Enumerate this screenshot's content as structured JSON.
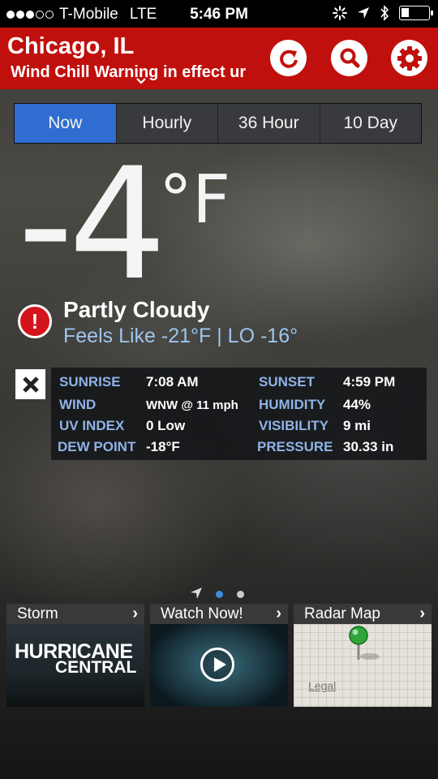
{
  "status_bar": {
    "carrier": "T-Mobile",
    "network": "LTE",
    "time": "5:46 PM"
  },
  "header": {
    "city": "Chicago, IL",
    "alert": "Wind Chill Warning in effect ur",
    "icons": [
      "refresh-icon",
      "search-icon",
      "gear-icon"
    ]
  },
  "tabs": [
    "Now",
    "Hourly",
    "36 Hour",
    "10 Day"
  ],
  "active_tab": "Now",
  "current": {
    "temperature": "-4",
    "unit": "°F",
    "condition": "Partly Cloudy",
    "feels_like": "Feels Like -21°F |  LO -16°"
  },
  "details": [
    {
      "label": "SUNRISE",
      "value": "7:08 AM",
      "label2": "SUNSET",
      "value2": "4:59 PM"
    },
    {
      "label": "WIND",
      "value": "WNW @ 11 mph",
      "label2": "HUMIDITY",
      "value2": "44%"
    },
    {
      "label": "UV INDEX",
      "value": "0 Low",
      "label2": "VISIBILITY",
      "value2": "9 mi"
    },
    {
      "label": "DEW POINT",
      "value": "-18°F",
      "label2": "PRESSURE",
      "value2": "30.33 in"
    }
  ],
  "cards": [
    {
      "title": "Storm",
      "line1": "HURRICANE",
      "line2": "CENTRAL"
    },
    {
      "title": "Watch Now!"
    },
    {
      "title": "Radar Map",
      "legal": "Legal"
    }
  ],
  "colors": {
    "header_red": "#c0100d",
    "active_tab": "#2f6ed0",
    "label_blue": "#8fb3e6",
    "feels_blue": "#9cc6ee"
  }
}
